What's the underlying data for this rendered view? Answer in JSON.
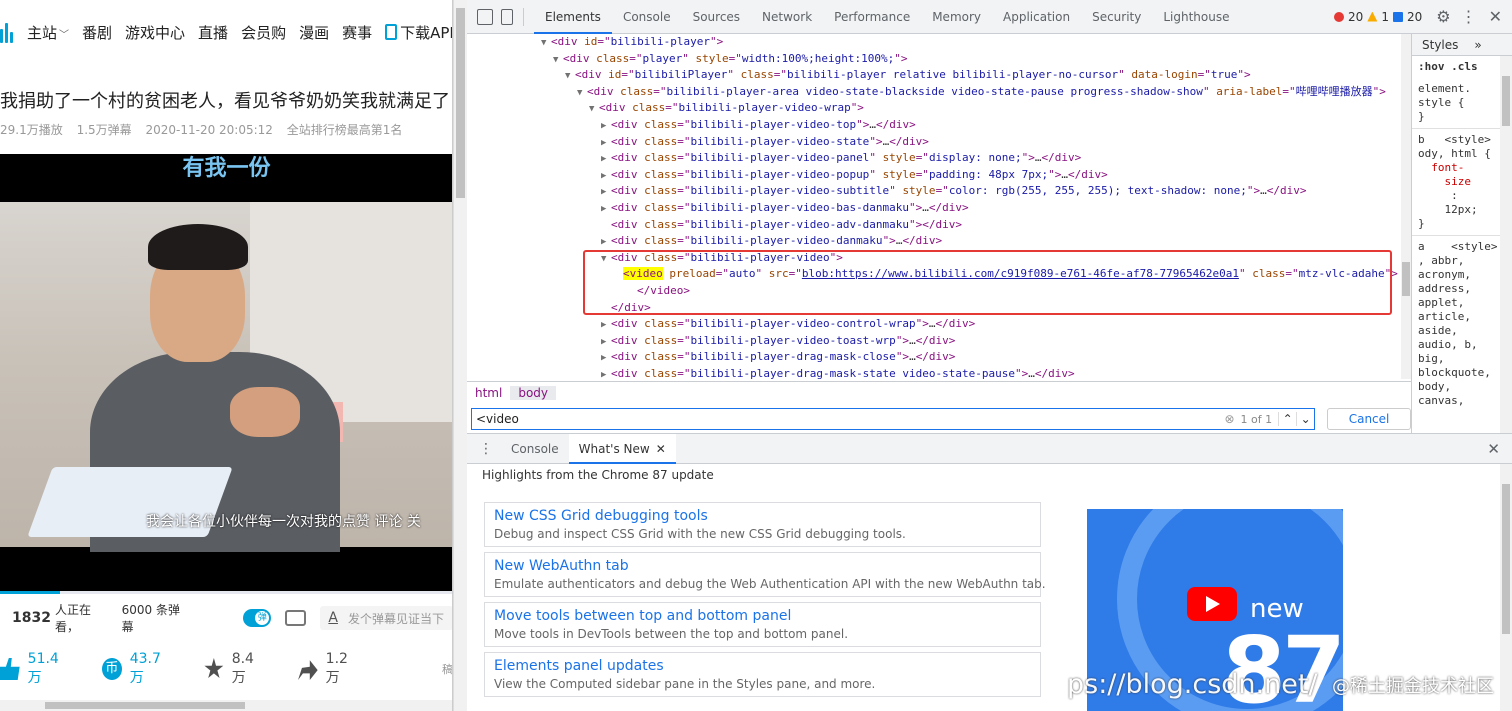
{
  "page": {
    "nav": [
      "主站",
      "番剧",
      "游戏中心",
      "直播",
      "会员购",
      "漫画",
      "赛事"
    ],
    "download_app": "下载APP",
    "video_title": "我捐助了一个村的贫困老人，看见爷爷奶奶笑我就满足了【",
    "meta": [
      "29.1万播放",
      "1.5万弹幕",
      "2020-11-20 20:05:12",
      "全站排行榜最高第1名"
    ],
    "banner": "有我一份",
    "subtitle": "我会让各位小伙伴每一次对我的点赞 评论 关",
    "viewers_count": "1832",
    "viewers_label": "人正在看，",
    "danmaku_count": "6000 条弹幕",
    "danmaku_placeholder": "发个弹幕见证当下",
    "danmaku_a": "A",
    "likes": "51.4万",
    "coins": "43.7万",
    "favorites": "8.4万",
    "shares": "1.2万",
    "coin_glyph": "币",
    "more_cut": "稿"
  },
  "devtools": {
    "tabs": [
      "Elements",
      "Console",
      "Sources",
      "Network",
      "Performance",
      "Memory",
      "Application",
      "Security",
      "Lighthouse"
    ],
    "errors": "20",
    "warnings": "1",
    "messages": "20",
    "breadcrumbs": [
      "html",
      "body"
    ],
    "search_query": "<video",
    "search_result": "1 of 1",
    "cancel_label": "Cancel",
    "styles_tab": "Styles",
    "styles_more": "»",
    "styles_filter": ":hov .cls",
    "drawer_tabs": [
      "Console",
      "What's New"
    ],
    "highlights": "Highlights from the Chrome 87 update",
    "cards": [
      {
        "title": "New CSS Grid debugging tools",
        "desc": "Debug and inspect CSS Grid with the new CSS Grid debugging tools."
      },
      {
        "title": "New WebAuthn tab",
        "desc": "Emulate authenticators and debug the Web Authentication API with the new WebAuthn tab."
      },
      {
        "title": "Move tools between top and bottom panel",
        "desc": "Move tools in DevTools between the top and bottom panel."
      },
      {
        "title": "Elements panel updates",
        "desc": "View the Computed sidebar pane in the Styles pane, and more."
      }
    ],
    "promo_new": "new",
    "promo_num": "87",
    "watermark": "ps://blog.csdn.net/",
    "watermark2": "@稀土掘金技术社区"
  }
}
